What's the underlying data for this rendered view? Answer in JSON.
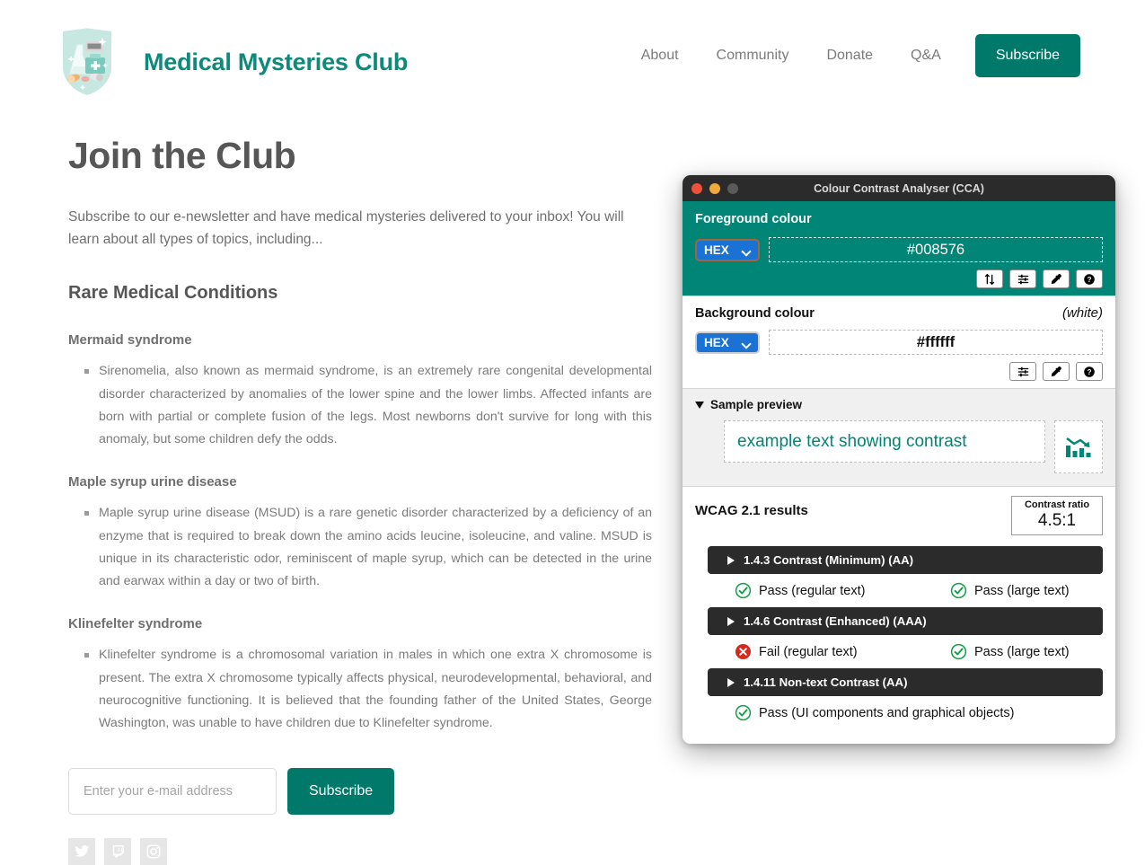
{
  "site": {
    "brand_title": "Medical Mysteries Club",
    "logo_icon": "medical-shield-badge-icon",
    "nav_links": [
      {
        "label": "About"
      },
      {
        "label": "Community"
      },
      {
        "label": "Donate"
      },
      {
        "label": "Q&A"
      }
    ],
    "nav_subscribe_label": "Subscribe",
    "brand_color": "#0d8a7a",
    "accent_button_color": "#00796b"
  },
  "main": {
    "page_title": "Join the Club",
    "intro": "Subscribe to our e-newsletter and have medical mysteries delivered to your inbox! You will learn about all types of topics, including...",
    "section_heading": "Rare Medical Conditions",
    "conditions": [
      {
        "title": "Mermaid syndrome",
        "body": "Sirenomelia, also known as mermaid syndrome, is an extremely rare congenital developmental disorder characterized by anomalies of the lower spine and the lower limbs. Affected infants are born with partial or complete fusion of the legs. Most newborns don't survive for long with this anomaly, but some children defy the odds."
      },
      {
        "title": "Maple syrup urine disease",
        "body": "Maple syrup urine disease (MSUD) is a rare genetic disorder characterized by a deficiency of an enzyme that is required to break down the amino acids leucine, isoleucine, and valine. MSUD is unique in its characteristic odor, reminiscent of maple syrup, which can be detected in the urine and earwax within a day or two of birth."
      },
      {
        "title": "Klinefelter syndrome",
        "body": "Klinefelter syndrome is a chromosomal variation in males in which one extra X chromosome is present. The extra X chromosome typically affects physical, neurodevelopmental, behavioral, and neurocognitive functioning. It is believed that the founding father of the United States, George Washington, was unable to have children due to Klinefelter syndrome."
      }
    ],
    "form": {
      "email_placeholder": "Enter your e-mail address",
      "email_value": "",
      "submit_label": "Subscribe"
    },
    "social_icons": [
      {
        "name": "twitter-icon"
      },
      {
        "name": "twitch-icon"
      },
      {
        "name": "instagram-icon"
      }
    ]
  },
  "cca": {
    "window_title": "Colour Contrast Analyser (CCA)",
    "traffic_lights": {
      "close": "close-window-button",
      "minimize": "minimize-window-button",
      "maximize": "maximize-window-button"
    },
    "foreground": {
      "label": "Foreground colour",
      "format": "HEX",
      "value": "#008576",
      "panel_color": "#008576",
      "tools": [
        {
          "name": "swap-colours-icon"
        },
        {
          "name": "sliders-icon"
        },
        {
          "name": "eyedropper-icon"
        },
        {
          "name": "help-icon"
        }
      ]
    },
    "background": {
      "label": "Background colour",
      "colour_name": "(white)",
      "format": "HEX",
      "value": "#ffffff",
      "tools": [
        {
          "name": "sliders-icon"
        },
        {
          "name": "eyedropper-icon"
        },
        {
          "name": "help-icon"
        }
      ]
    },
    "sample_preview": {
      "label": "Sample preview",
      "expanded": true,
      "sample_text": "example text showing contrast",
      "sample_text_color": "#008576",
      "graphic_icon": "declining-bar-chart-icon"
    },
    "wcag": {
      "title": "WCAG 2.1 results",
      "contrast_ratio_label": "Contrast ratio",
      "contrast_ratio_value": "4.5:1",
      "criteria": [
        {
          "name": "1.4.3 Contrast (Minimum) (AA)",
          "expanded": false,
          "results": [
            {
              "status": "pass",
              "label": "Pass (regular text)"
            },
            {
              "status": "pass",
              "label": "Pass (large text)"
            }
          ]
        },
        {
          "name": "1.4.6 Contrast (Enhanced) (AAA)",
          "expanded": false,
          "results": [
            {
              "status": "fail",
              "label": "Fail (regular text)"
            },
            {
              "status": "pass",
              "label": "Pass (large text)"
            }
          ]
        },
        {
          "name": "1.4.11 Non-text Contrast (AA)",
          "expanded": false,
          "results": [
            {
              "status": "pass",
              "label": "Pass (UI components and graphical objects)"
            }
          ]
        }
      ],
      "status_colors": {
        "pass": "#11a044",
        "fail": "#d42a1f"
      }
    }
  }
}
